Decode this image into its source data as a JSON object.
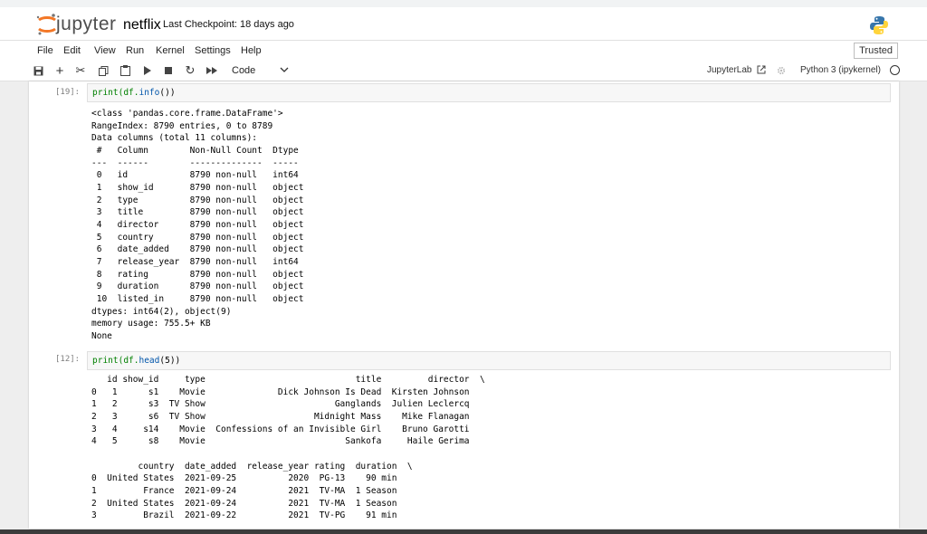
{
  "header": {
    "logo_text": "jupyter",
    "notebook_name": "netflix",
    "checkpoint": "Last Checkpoint: 18 days ago"
  },
  "menu": [
    "File",
    "Edit",
    "View",
    "Run",
    "Kernel",
    "Settings",
    "Help"
  ],
  "trusted": "Trusted",
  "toolbar": {
    "cell_type": "Code",
    "jupyterlab_label": "JupyterLab",
    "kernel_name": "Python 3 (ipykernel)"
  },
  "cells": [
    {
      "prompt": "[19]:",
      "code_prefix": "print(df.",
      "code_attr": "info",
      "code_suffix": "())",
      "output": "<class 'pandas.core.frame.DataFrame'>\nRangeIndex: 8790 entries, 0 to 8789\nData columns (total 11 columns):\n #   Column        Non-Null Count  Dtype \n---  ------        --------------  ----- \n 0   id            8790 non-null   int64 \n 1   show_id       8790 non-null   object\n 2   type          8790 non-null   object\n 3   title         8790 non-null   object\n 4   director      8790 non-null   object\n 5   country       8790 non-null   object\n 6   date_added    8790 non-null   object\n 7   release_year  8790 non-null   int64 \n 8   rating        8790 non-null   object\n 9   duration      8790 non-null   object\n 10  listed_in     8790 non-null   object\ndtypes: int64(2), object(9)\nmemory usage: 755.5+ KB\nNone"
    },
    {
      "prompt": "[12]:",
      "code_prefix": "print(df.",
      "code_attr": "head",
      "code_suffix": "(5))",
      "output": "   id show_id     type                             title         director  \\\n0   1      s1    Movie              Dick Johnson Is Dead  Kirsten Johnson   \n1   2      s3  TV Show                         Ganglands  Julien Leclercq   \n2   3      s6  TV Show                     Midnight Mass    Mike Flanagan   \n3   4     s14    Movie  Confessions of an Invisible Girl    Bruno Garotti   \n4   5      s8    Movie                           Sankofa     Haile Gerima   \n\n         country  date_added  release_year rating  duration  \\\n0  United States  2021-09-25          2020  PG-13    90 min   \n1         France  2021-09-24          2021  TV-MA  1 Season   \n2  United States  2021-09-24          2021  TV-MA  1 Season   \n3         Brazil  2021-09-22          2021  TV-PG    91 min   "
    }
  ]
}
